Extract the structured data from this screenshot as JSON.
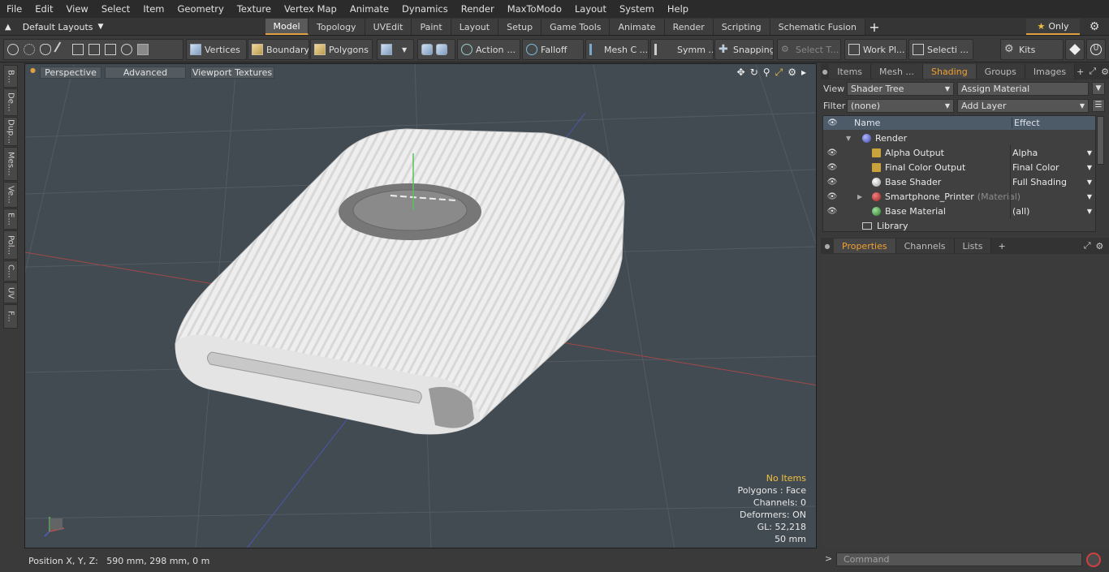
{
  "menu": [
    "File",
    "Edit",
    "View",
    "Select",
    "Item",
    "Geometry",
    "Texture",
    "Vertex Map",
    "Animate",
    "Dynamics",
    "Render",
    "MaxToModo",
    "Layout",
    "System",
    "Help"
  ],
  "layout_selector": "Default Layouts",
  "tabs": [
    "Model",
    "Topology",
    "UVEdit",
    "Paint",
    "Layout",
    "Setup",
    "Game Tools",
    "Animate",
    "Render",
    "Scripting",
    "Schematic Fusion"
  ],
  "only_label": "Only",
  "toolbar": {
    "vertices": "Vertices",
    "boundary": "Boundary",
    "polygons": "Polygons",
    "action": "Action",
    "falloff": "Falloff",
    "mesh": "Mesh C ...",
    "symm": "Symm ...",
    "snapping": "Snapping",
    "select_t": "Select T...",
    "work_pl": "Work Pl...",
    "selecti": "Selecti ...",
    "kits": "Kits"
  },
  "left_tabs": [
    "B...",
    "De...",
    "Dup...",
    "Mes...",
    "Ve...",
    "E...",
    "Pol...",
    "C...",
    "UV",
    "F..."
  ],
  "viewport": {
    "perspective": "Perspective",
    "advanced": "Advanced",
    "viewport_textures": "Viewport Textures",
    "info": {
      "no_items": "No Items",
      "polygons": "Polygons : Face",
      "channels": "Channels: 0",
      "deformers": "Deformers: ON",
      "gl": "GL: 52,218",
      "scale": "50 mm"
    }
  },
  "status": "Position X, Y, Z:   590 mm, 298 mm, 0 m",
  "panel_tabs": [
    "Items",
    "Mesh ...",
    "Shading",
    "Groups",
    "Images"
  ],
  "shading": {
    "view_label": "View",
    "view_value": "Shader Tree",
    "assign_material": "Assign Material",
    "filter_label": "Filter",
    "filter_value": "(none)",
    "add_layer": "Add Layer",
    "col_name": "Name",
    "col_effect": "Effect",
    "rows": [
      {
        "name": "Render",
        "suffix": "",
        "effect": "",
        "ball": "#5a6ab8"
      },
      {
        "name": "Alpha Output",
        "suffix": "",
        "effect": "Alpha",
        "ball": "#c9a23c"
      },
      {
        "name": "Final Color Output",
        "suffix": "",
        "effect": "Final Color",
        "ball": "#c9a23c"
      },
      {
        "name": "Base Shader",
        "suffix": "",
        "effect": "Full Shading",
        "ball": "#e0e0e0"
      },
      {
        "name": "Smartphone_Printer",
        "suffix": "(Material)",
        "effect": "",
        "ball": "#c0392b"
      },
      {
        "name": "Base Material",
        "suffix": "",
        "effect": "(all)",
        "ball": "#3ca040"
      },
      {
        "name": "Library",
        "suffix": "",
        "effect": "",
        "ball": ""
      }
    ]
  },
  "bottom_tabs": [
    "Properties",
    "Channels",
    "Lists"
  ],
  "command_placeholder": "Command",
  "colors": {
    "accent": "#f0a030",
    "viewport_bg": "#434b52"
  }
}
